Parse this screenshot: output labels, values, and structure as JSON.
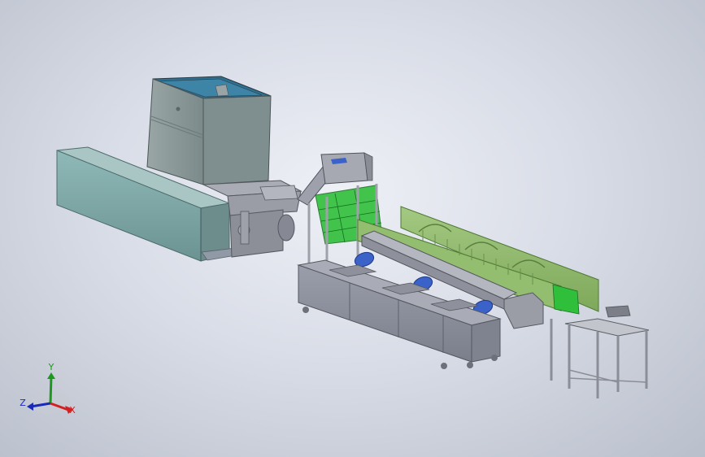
{
  "triad": {
    "x_label": "X",
    "y_label": "Y",
    "z_label": "Z",
    "colors": {
      "x": "#d42020",
      "y": "#1a9a1a",
      "z": "#1a2ab8"
    }
  },
  "palette": {
    "background": "#d9dde7",
    "hopper": "#8a9a9a",
    "hopper_top": "#2f6f8f",
    "conveyor_teal": "#7fa9a8",
    "steel": "#8e939e",
    "tank": "#8c8f9c",
    "green_panel": "#8fb96a",
    "green_bright": "#2fbf3a",
    "motor_blue": "#3a62c8",
    "frame": "#a8abb3"
  }
}
